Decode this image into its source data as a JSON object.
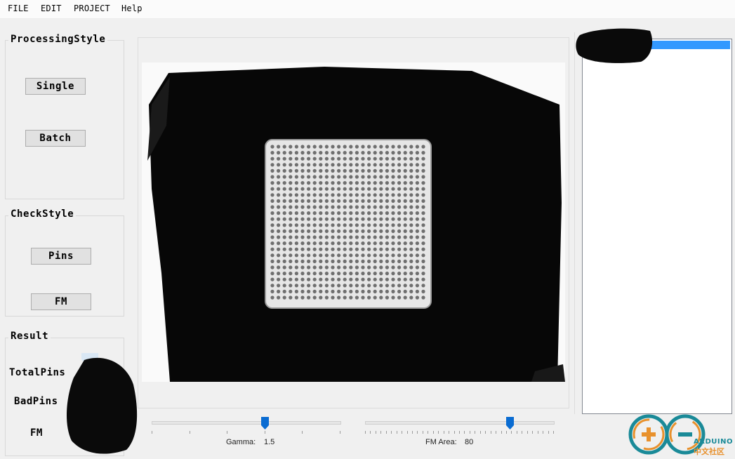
{
  "menu": {
    "file": "FILE",
    "edit": "EDIT",
    "project": "PROJECT",
    "help": "Help"
  },
  "processing": {
    "title": "ProcessingStyle",
    "single": "Single",
    "batch": "Batch"
  },
  "check": {
    "title": "CheckStyle",
    "pins": "Pins",
    "fm": "FM"
  },
  "result": {
    "title": "Result",
    "total_pins": "TotalPins",
    "bad_pins": "BadPins",
    "fm": "FM"
  },
  "sliders": {
    "gamma": {
      "label": "Gamma:",
      "value": "1.5",
      "position": 0.6
    },
    "fm_area": {
      "label": "FM Area:",
      "value": "80",
      "position": 0.77
    }
  },
  "listbox": {
    "selected_index": 0
  },
  "watermark": {
    "brand": "ARDUINO",
    "subtitle": "中文社区"
  },
  "colors": {
    "selection": "#3399ff",
    "slider_thumb": "#0a6cd2",
    "watermark_teal": "#1a8a98",
    "watermark_orange": "#e8912d"
  }
}
